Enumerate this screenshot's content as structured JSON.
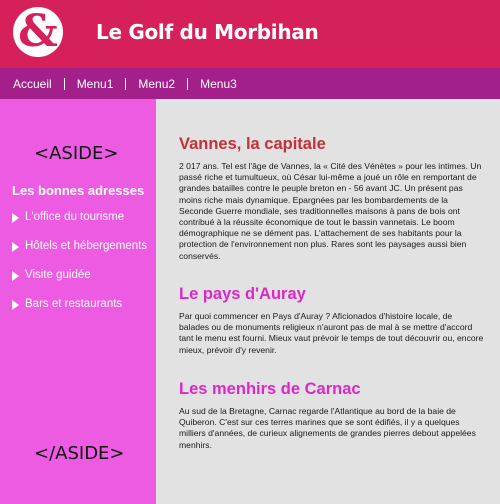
{
  "header": {
    "logo_glyph": "&",
    "title": "Le Golf du Morbihan"
  },
  "nav": {
    "items": [
      "Accueil",
      "Menu1",
      "Menu2",
      "Menu3"
    ]
  },
  "aside": {
    "open_tag": "<ASIDE>",
    "close_tag": "</ASIDE>",
    "heading": "Les bonnes adresses",
    "links": [
      "L'office du tourisme",
      "Hôtels et hébergements",
      "Visite guidée",
      "Bars et restaurants"
    ]
  },
  "main": {
    "sections": [
      {
        "title": "Vannes, la capitale",
        "text": "2 017 ans. Tel est l'âge de Vannes, la « Cité des Vénètes » pour les intimes. Un passé riche et tumultueux, où César lui-même a joué un rôle en remportant de grandes batailles contre le peuple breton en - 56 avant JC. Un présent pas moins riche mais dynamique. Epargnées par les bombardements de la Seconde Guerre mondiale, ses traditionnelles maisons à pans de bois ont contribué à la réussite économique de tout le bassin vannetais. Le boom démographique ne se dément pas. L'attachement de ses habitants pour la protection de l'environnement non plus. Rares sont les paysages aussi bien conservés."
      },
      {
        "title": "Le pays d'Auray",
        "text": "Par quoi commencer en Pays d'Auray ? Aficionados d'histoire locale, de balades ou de monuments religieux n'auront pas de mal à se mettre d'accord tant le menu est fourni. Mieux vaut prévoir le temps de tout découvrir ou, encore mieux, prévoir d'y revenir."
      },
      {
        "title": "Les menhirs de Carnac",
        "text": "Au sud de la Bretagne, Carnac regarde l'Atlantique au bord de la baie de Quiberon. C'est sur ces terres marines que se sont édifiés, il y a quelques milliers d'années, de curieux alignements de grandes pierres debout appelées menhirs."
      }
    ]
  }
}
